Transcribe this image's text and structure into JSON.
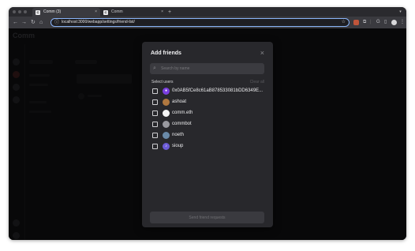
{
  "browser": {
    "tabs": [
      {
        "favicon": "C",
        "title": "Comm (3)",
        "active": true
      },
      {
        "favicon": "C",
        "title": "Comm",
        "active": false
      }
    ],
    "new_tab": "+",
    "tab_close": "×",
    "url": "localhost:3000/webapp/settings/friend-list/",
    "nav": {
      "back": "←",
      "forward": "→",
      "reload": "↻",
      "home": "⌂"
    },
    "ext_letter": "G"
  },
  "app": {
    "logo": "Comm"
  },
  "modal": {
    "title": "Add friends",
    "close": "×",
    "search": {
      "placeholder": "Search by name",
      "value": ""
    },
    "select_label": "Select users",
    "clear_label": "Clear all",
    "users": [
      {
        "name": "0x0AB5fCe8c61aB878533081bDD6349E...",
        "avatar_color": "#7a3fe0",
        "avatar_glyph": "♦"
      },
      {
        "name": "ashoat",
        "avatar_color": "#b07840",
        "avatar_glyph": ""
      },
      {
        "name": "comm.eth",
        "avatar_color": "#f4f4f4",
        "avatar_glyph": ""
      },
      {
        "name": "commbot",
        "avatar_color": "#9a9aa0",
        "avatar_glyph": ""
      },
      {
        "name": "noeth",
        "avatar_color": "#6a8aa8",
        "avatar_glyph": ""
      },
      {
        "name": "sioup",
        "avatar_color": "#6b5bd6",
        "avatar_glyph": "♪"
      }
    ],
    "send_label": "Send friend requests"
  }
}
